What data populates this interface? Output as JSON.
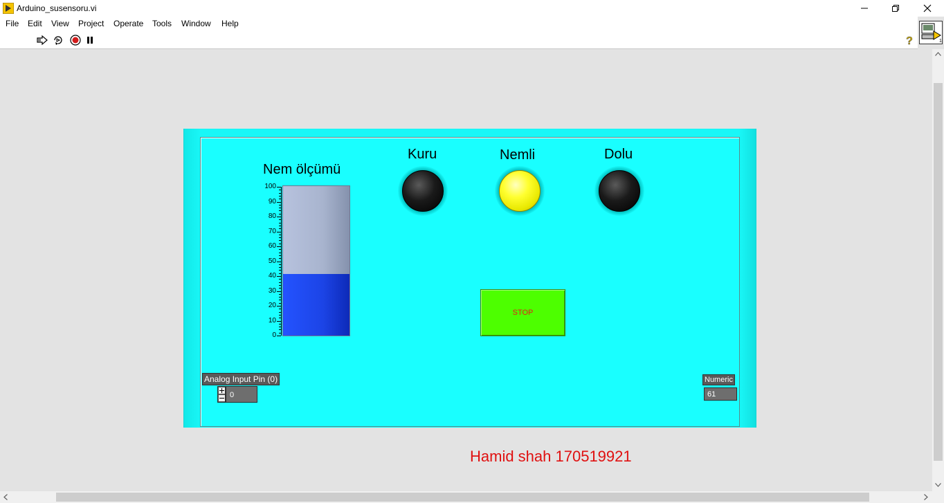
{
  "window": {
    "title": "Arduino_susensoru.vi",
    "controls": [
      "minimize",
      "restore",
      "close"
    ]
  },
  "menu": [
    "File",
    "Edit",
    "View",
    "Project",
    "Operate",
    "Tools",
    "Window",
    "Help"
  ],
  "toolbar": {
    "icons": [
      "run-arrow-icon",
      "run-continuously-icon",
      "abort-icon",
      "pause-icon"
    ],
    "help_icon": "question-mark-icon"
  },
  "panel": {
    "background": "#19ffff",
    "tank": {
      "title": "Nem ölçümü",
      "scale": [
        "0",
        "10",
        "20",
        "30",
        "40",
        "50",
        "60",
        "70",
        "80",
        "90",
        "100"
      ],
      "value": 41,
      "min": 0,
      "max": 100
    },
    "leds": [
      {
        "label": "Kuru",
        "state": "off",
        "color": "#0a0a0a"
      },
      {
        "label": "Nemli",
        "state": "on",
        "color": "#ffff00"
      },
      {
        "label": "Dolu",
        "state": "off",
        "color": "#0a0a0a"
      }
    ],
    "stop_button": {
      "label": "STOP",
      "color": "#4dff00"
    },
    "analog_input": {
      "label": "Analog Input Pin (0)",
      "value": "0"
    },
    "numeric": {
      "label": "Numeric",
      "value": "61"
    }
  },
  "footer": {
    "text": "Hamid shah 170519921",
    "color": "#e01010"
  }
}
